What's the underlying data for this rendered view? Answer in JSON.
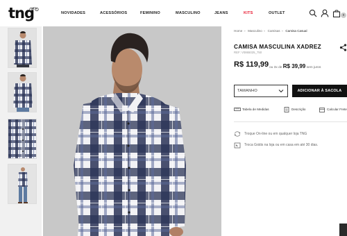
{
  "header": {
    "logo": "tng",
    "nav": [
      {
        "label": "NOVIDADES"
      },
      {
        "label": "ACESSÓRIOS"
      },
      {
        "label": "FEMININO"
      },
      {
        "label": "MASCULINO"
      },
      {
        "label": "JEANS"
      },
      {
        "label": "KITS"
      },
      {
        "label": "OUTLET"
      }
    ],
    "icons": [
      "search-icon",
      "user-icon",
      "bag-icon"
    ],
    "cart_count": "0",
    "accent_color": "#e8162d"
  },
  "breadcrumb": [
    "Home",
    "Masculino",
    "Camisas",
    "Camisa Casual"
  ],
  "product": {
    "title": "CAMISA MASCULINA XADREZ",
    "ref": "REF: V0865025_750",
    "price": "R$ 119,99",
    "installments_prefix": "ou 3x de",
    "installment_value": "R$ 39,99",
    "installments_suffix": "sem juros",
    "size_label": "TAMANHO",
    "add_button": "ADICIONAR À SACOLA"
  },
  "links": {
    "size_table": "Tabela de Medidas",
    "description": "Descrição",
    "shipping": "Calcular Frete"
  },
  "info": {
    "exchange": "Troque On-line ou em qualquer loja TNG",
    "free_exchange": "Troca Grátis na loja ou em casa em até 30 dias."
  }
}
